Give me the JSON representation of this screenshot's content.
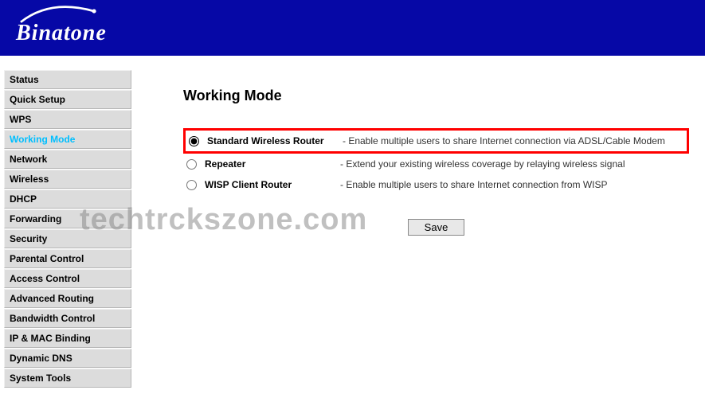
{
  "header": {
    "logo_text": "Binatone"
  },
  "sidebar": {
    "items": [
      {
        "label": "Status",
        "active": false
      },
      {
        "label": "Quick Setup",
        "active": false
      },
      {
        "label": "WPS",
        "active": false
      },
      {
        "label": "Working Mode",
        "active": true
      },
      {
        "label": "Network",
        "active": false
      },
      {
        "label": "Wireless",
        "active": false
      },
      {
        "label": "DHCP",
        "active": false
      },
      {
        "label": "Forwarding",
        "active": false
      },
      {
        "label": "Security",
        "active": false
      },
      {
        "label": "Parental Control",
        "active": false
      },
      {
        "label": "Access Control",
        "active": false
      },
      {
        "label": "Advanced Routing",
        "active": false
      },
      {
        "label": "Bandwidth Control",
        "active": false
      },
      {
        "label": "IP & MAC Binding",
        "active": false
      },
      {
        "label": "Dynamic DNS",
        "active": false
      },
      {
        "label": "System Tools",
        "active": false
      }
    ]
  },
  "main": {
    "title": "Working Mode",
    "options": [
      {
        "label": "Standard Wireless Router",
        "desc": "- Enable multiple users to share Internet connection via ADSL/Cable Modem",
        "selected": true,
        "highlighted": true
      },
      {
        "label": "Repeater",
        "desc": "- Extend your existing wireless coverage by relaying wireless signal",
        "selected": false,
        "highlighted": false
      },
      {
        "label": "WISP Client Router",
        "desc": "- Enable multiple users to share Internet connection from WISP",
        "selected": false,
        "highlighted": false
      }
    ],
    "save_label": "Save"
  },
  "watermark": "techtrckszone.com"
}
